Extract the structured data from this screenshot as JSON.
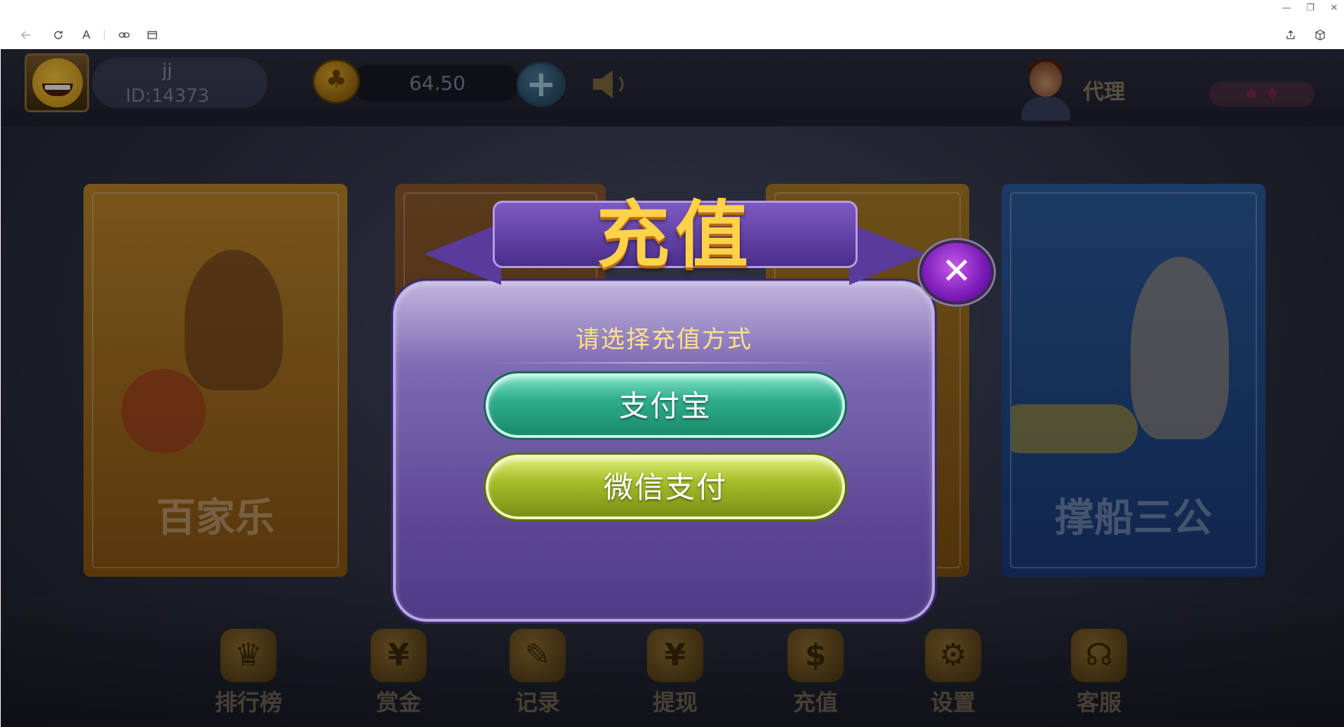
{
  "browser": {
    "window_controls": {
      "minimize": "—",
      "restore": "❐",
      "close": "✕"
    },
    "toolbar": {
      "back_icon": "back-arrow-icon",
      "refresh_icon": "refresh-icon",
      "reader_label": "A",
      "link_icon": "link-icon",
      "tab_icon": "tab-icon",
      "share_icon": "share-icon",
      "extension_icon": "cube-icon"
    }
  },
  "user": {
    "name": "jj",
    "id_label": "ID:14373"
  },
  "wallet": {
    "balance": "64.50",
    "add_label": "+"
  },
  "agent": {
    "label": "代理"
  },
  "games": [
    {
      "title": "百家乐"
    },
    {
      "title": ""
    },
    {
      "title": ""
    },
    {
      "title": "撑船三公"
    }
  ],
  "bottom_nav": [
    {
      "label": "排行榜",
      "icon": "trophy-icon",
      "glyph": "♛"
    },
    {
      "label": "赏金",
      "icon": "money-bag-icon",
      "glyph": "¥"
    },
    {
      "label": "记录",
      "icon": "record-icon",
      "glyph": "✎"
    },
    {
      "label": "提现",
      "icon": "withdraw-icon",
      "glyph": "¥"
    },
    {
      "label": "充值",
      "icon": "recharge-icon",
      "glyph": "$"
    },
    {
      "label": "设置",
      "icon": "gear-icon",
      "glyph": "⚙"
    },
    {
      "label": "客服",
      "icon": "headset-icon",
      "glyph": "☊"
    }
  ],
  "modal": {
    "title": "充值",
    "prompt": "请选择充值方式",
    "options": {
      "alipay": "支付宝",
      "wechat": "微信支付"
    },
    "close_label": "✕"
  },
  "colors": {
    "modal_bg": "#6a54a4",
    "title_gold": "#ffd24a",
    "alipay_green": "#2fae8c",
    "wechat_olive": "#a6be2a",
    "close_purple": "#7a1ab8"
  }
}
